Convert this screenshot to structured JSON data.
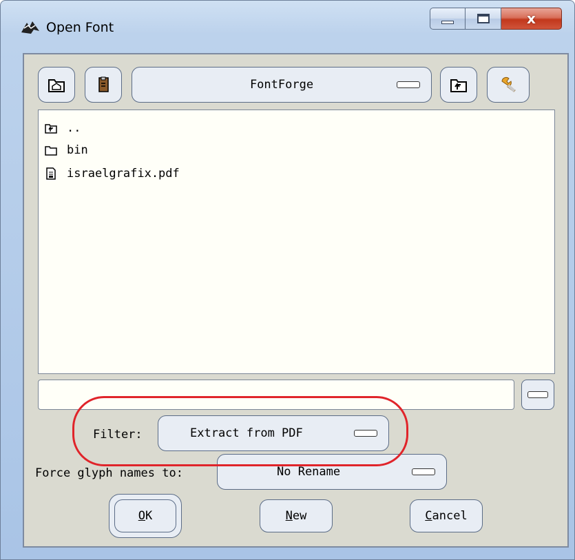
{
  "window": {
    "title": "Open Font",
    "buttons": {
      "minimize": "minimize",
      "maximize": "maximize",
      "close": "x"
    }
  },
  "toolbar": {
    "home_icon": "home-folder-icon",
    "bookmark_icon": "bookmarks-icon",
    "path_value": "FontForge",
    "up_icon": "parent-folder-icon",
    "tools_icon": "wrench-icon"
  },
  "files": [
    {
      "name": "..",
      "type": "parent-folder"
    },
    {
      "name": "bin",
      "type": "folder"
    },
    {
      "name": "israelgrafix.pdf",
      "type": "file"
    }
  ],
  "filename_input": {
    "value": ""
  },
  "filter": {
    "label": "Filter:",
    "value": "Extract from PDF"
  },
  "rename": {
    "label": "Force glyph names to:",
    "value": "No Rename"
  },
  "actions": {
    "ok_letter": "O",
    "ok_rest": "K",
    "new_letter": "N",
    "new_rest": "ew",
    "cancel_letter": "C",
    "cancel_rest": "ancel"
  },
  "colors": {
    "annotation_circle": "#e0242a",
    "list_background": "#fffff8",
    "dialog_background": "#dadad0"
  }
}
